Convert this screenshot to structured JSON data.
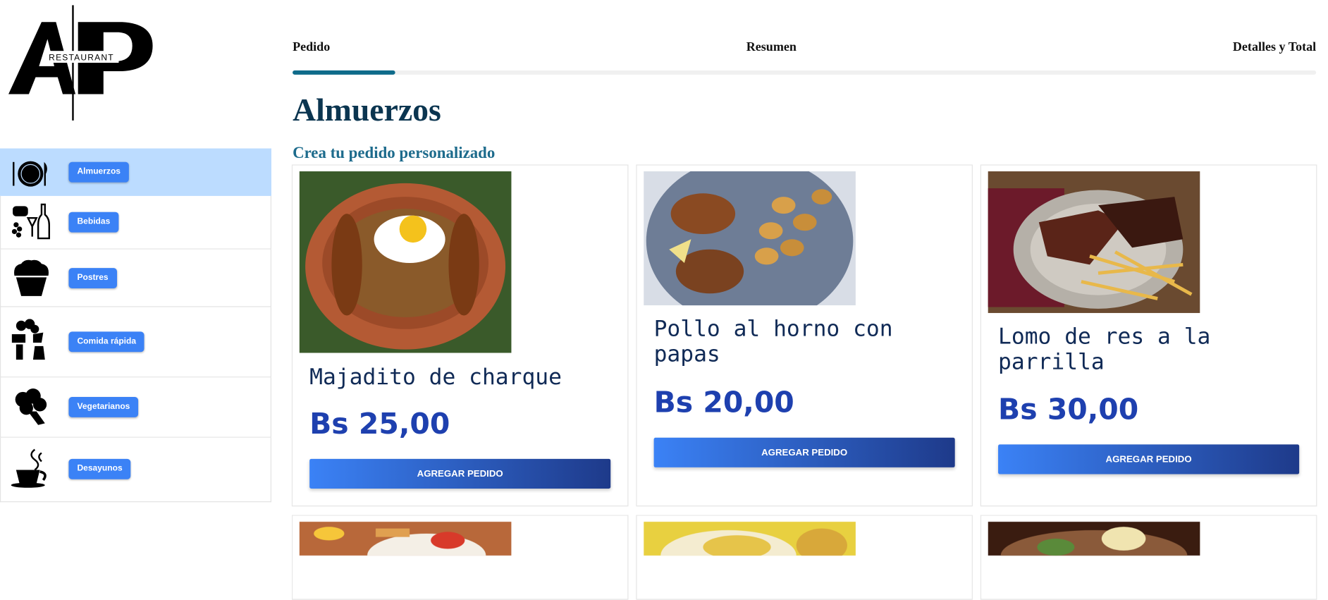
{
  "brand": {
    "logo_text": "RESTAURANT"
  },
  "sidebar": {
    "items": [
      {
        "label": "Almuerzos",
        "icon": "plate-cutlery-icon",
        "active": true
      },
      {
        "label": "Bebidas",
        "icon": "drinks-icon"
      },
      {
        "label": "Postres",
        "icon": "cupcake-icon"
      },
      {
        "label": "Comida rápida",
        "icon": "fast-food-icon"
      },
      {
        "label": "Vegetarianos",
        "icon": "broccoli-icon"
      },
      {
        "label": "Desayunos",
        "icon": "coffee-cup-icon"
      }
    ]
  },
  "steps": {
    "items": [
      "Pedido",
      "Resumen",
      "Detalles y Total"
    ],
    "progress": 0.1
  },
  "main": {
    "title": "Almuerzos",
    "subtitle": "Crea tu pedido personalizado"
  },
  "dishes": [
    {
      "name": "Majadito de charque",
      "price": "Bs 25,00",
      "button": "AGREGAR PEDIDO"
    },
    {
      "name": "Pollo al horno con papas",
      "price": "Bs 20,00",
      "button": "AGREGAR PEDIDO"
    },
    {
      "name": "Lomo de res a la parrilla",
      "price": "Bs 30,00",
      "button": "AGREGAR PEDIDO"
    }
  ],
  "colors": {
    "accent": "#3b82f6",
    "active_bg": "#bcdcff",
    "title": "#0b3550",
    "price": "#1e40af",
    "progress": "#0f6b8a"
  }
}
